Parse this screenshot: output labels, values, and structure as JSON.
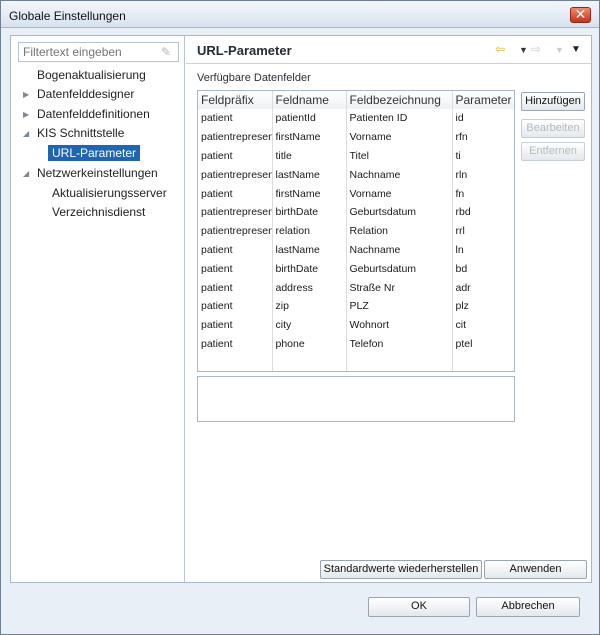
{
  "window": {
    "title": "Globale Einstellungen",
    "close_glyph": "✕"
  },
  "filter": {
    "placeholder": "Filtertext eingeben"
  },
  "tree": {
    "items": [
      {
        "label": "Bogenaktualisierung",
        "expandable": false
      },
      {
        "label": "Datenfelddesigner",
        "expandable": true
      },
      {
        "label": "Datenfelddefinitionen",
        "expandable": true
      },
      {
        "label": "KIS Schnittstelle",
        "expandable": true,
        "expanded": true
      },
      {
        "label": "URL-Parameter",
        "selected": true
      },
      {
        "label": "Netzwerkeinstellungen",
        "expandable": true,
        "expanded": true
      },
      {
        "label": "Aktualisierungsserver"
      },
      {
        "label": "Verzeichnisdienst"
      }
    ]
  },
  "page": {
    "title": "URL-Parameter",
    "section_label": "Verfügbare Datenfelder",
    "nav_icons": [
      "back-arrow-icon",
      "dropdown-icon",
      "forward-arrow-icon",
      "dropdown-icon",
      "menu-dropdown-icon"
    ]
  },
  "table": {
    "columns": [
      "Feldpräfix",
      "Feldname",
      "Feldbezeichnung",
      "Parameter"
    ],
    "rows": [
      [
        "patient",
        "patientId",
        "Patienten ID",
        "id"
      ],
      [
        "patientrepresentative",
        "firstName",
        "Vorname",
        "rfn"
      ],
      [
        "patient",
        "title",
        "Titel",
        "ti"
      ],
      [
        "patientrepresentative",
        "lastName",
        "Nachname",
        "rln"
      ],
      [
        "patient",
        "firstName",
        "Vorname",
        "fn"
      ],
      [
        "patientrepresentative",
        "birthDate",
        "Geburtsdatum",
        "rbd"
      ],
      [
        "patientrepresentative",
        "relation",
        "Relation",
        "rrl"
      ],
      [
        "patient",
        "lastName",
        "Nachname",
        "ln"
      ],
      [
        "patient",
        "birthDate",
        "Geburtsdatum",
        "bd"
      ],
      [
        "patient",
        "address",
        "Straße Nr",
        "adr"
      ],
      [
        "patient",
        "zip",
        "PLZ",
        "plz"
      ],
      [
        "patient",
        "city",
        "Wohnort",
        "cit"
      ],
      [
        "patient",
        "phone",
        "Telefon",
        "ptel"
      ]
    ]
  },
  "buttons": {
    "add": "Hinzufügen",
    "edit": "Bearbeiten",
    "remove": "Entfernen",
    "restore_defaults": "Standardwerte wiederherstellen",
    "apply": "Anwenden",
    "ok": "OK",
    "cancel": "Abbrechen"
  },
  "colors": {
    "selection": "#1f65b1",
    "close_button": "#d2401f",
    "nav_arrow": "#e8b820"
  }
}
